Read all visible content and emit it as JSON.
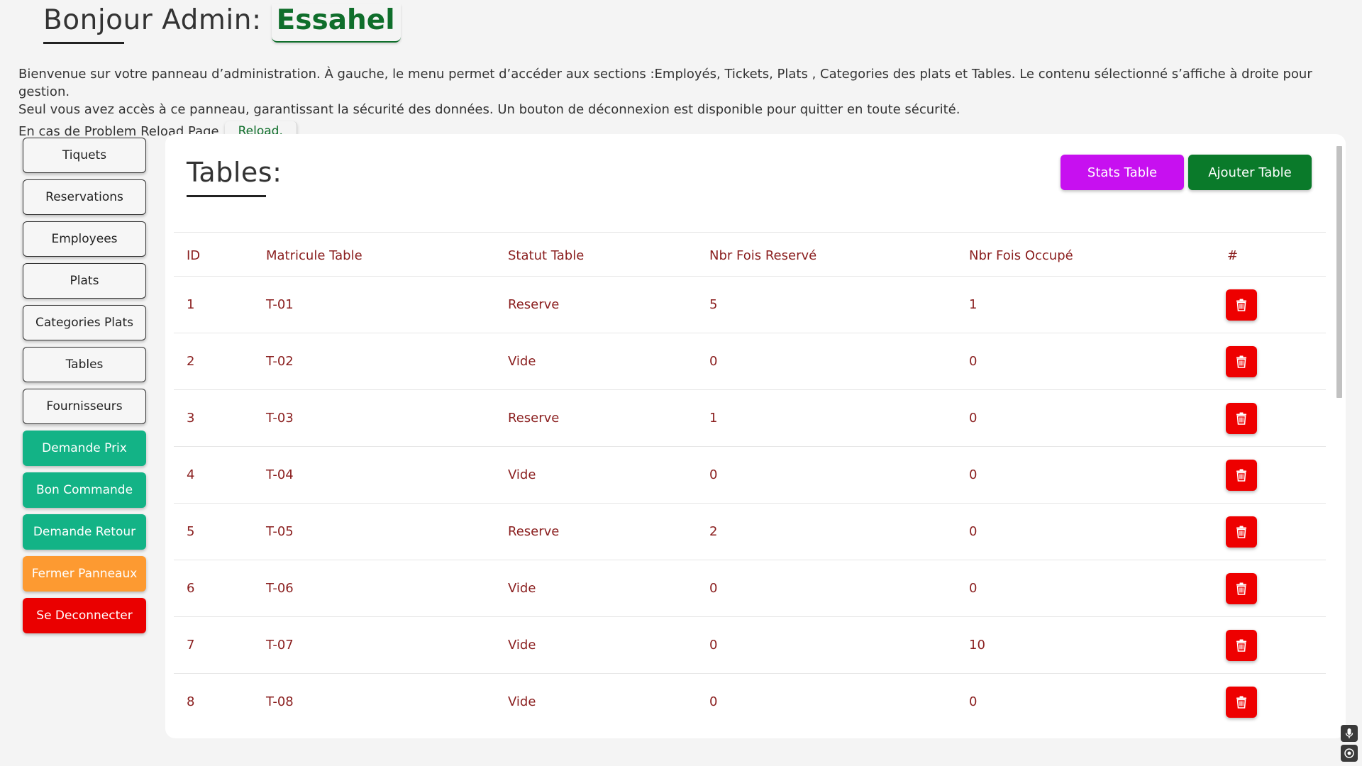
{
  "header": {
    "greeting": "Bonjour Admin:",
    "name": "Essahel"
  },
  "intro": {
    "line1": "Bienvenue sur votre panneau d’administration. À gauche, le menu permet d’accéder aux sections :Employés, Tickets, Plats , Categories des plats et Tables. Le contenu sélectionné s’affiche à droite pour gestion.",
    "line2": "Seul vous avez accès à ce panneau, garantissant la sécurité des données. Un bouton de déconnexion est disponible pour quitter en toute sécurité.",
    "reload_prefix": "En cas de Problem Reload Page",
    "reload_label": "Reload."
  },
  "sidebar": {
    "items": [
      {
        "label": "Tiquets",
        "style": "outline"
      },
      {
        "label": "Reservations",
        "style": "outline"
      },
      {
        "label": "Employees",
        "style": "outline"
      },
      {
        "label": "Plats",
        "style": "outline"
      },
      {
        "label": "Categories Plats",
        "style": "outline"
      },
      {
        "label": "Tables",
        "style": "outline"
      },
      {
        "label": "Fournisseurs",
        "style": "outline"
      },
      {
        "label": "Demande Prix",
        "style": "teal"
      },
      {
        "label": "Bon Commande",
        "style": "teal"
      },
      {
        "label": "Demande Retour",
        "style": "teal"
      },
      {
        "label": "Fermer Panneaux",
        "style": "orange"
      },
      {
        "label": "Se Deconnecter",
        "style": "red"
      }
    ]
  },
  "panel": {
    "title": "Tables:",
    "stats_label": "Stats Table",
    "add_label": "Ajouter Table"
  },
  "table": {
    "headers": [
      "ID",
      "Matricule Table",
      "Statut Table",
      "Nbr Fois Reservé",
      "Nbr Fois Occupé",
      "#"
    ],
    "rows": [
      [
        "1",
        "T-01",
        "Reserve",
        "5",
        "1"
      ],
      [
        "2",
        "T-02",
        "Vide",
        "0",
        "0"
      ],
      [
        "3",
        "T-03",
        "Reserve",
        "1",
        "0"
      ],
      [
        "4",
        "T-04",
        "Vide",
        "0",
        "0"
      ],
      [
        "5",
        "T-05",
        "Reserve",
        "2",
        "0"
      ],
      [
        "6",
        "T-06",
        "Vide",
        "0",
        "0"
      ],
      [
        "7",
        "T-07",
        "Vide",
        "0",
        "10"
      ],
      [
        "8",
        "T-08",
        "Vide",
        "0",
        "0"
      ]
    ],
    "delete_icon": "trash-icon"
  },
  "colors": {
    "brand_green": "#0f6e2b",
    "text_red": "#8a1e1e",
    "delete_red": "#ee0000",
    "stats_purple": "#c710f0",
    "add_green": "#0a7a2a",
    "teal": "#13b386",
    "orange": "#fd9a31",
    "logout_red": "#ea0000"
  }
}
